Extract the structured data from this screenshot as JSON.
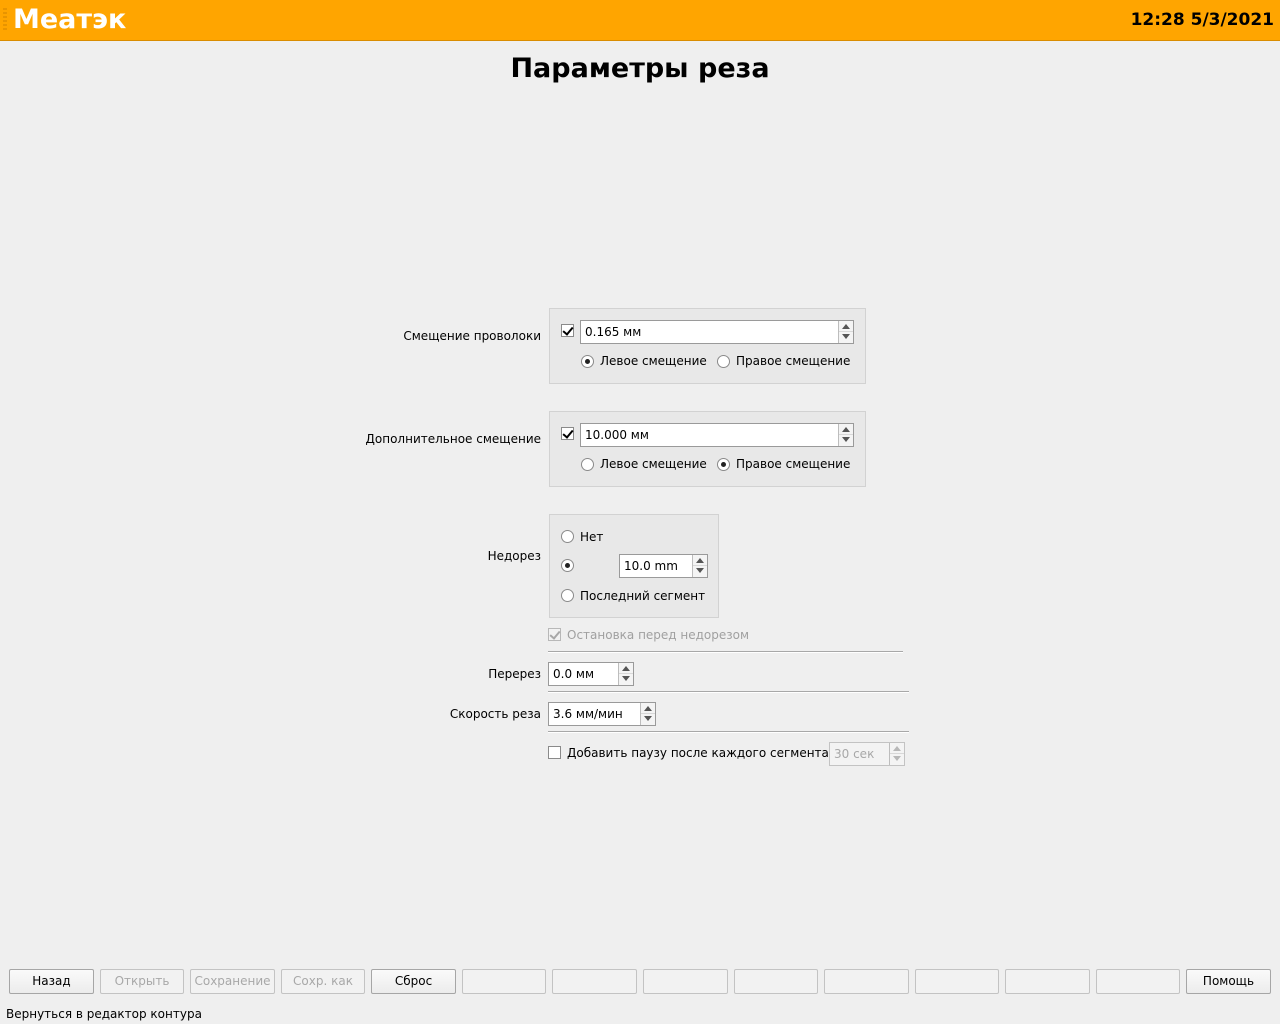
{
  "header": {
    "app_title": "Меатэк",
    "clock": "12:28 5/3/2021",
    "bg_color": "#ffa500"
  },
  "page_title": "Параметры реза",
  "wire_offset": {
    "label": "Смещение проволоки",
    "enabled": true,
    "value": "0.165 мм",
    "left_label": "Левое смещение",
    "right_label": "Правое смещение",
    "selected": "left"
  },
  "extra_offset": {
    "label": "Дополнительное смещение",
    "enabled": true,
    "value": "10.000 мм",
    "left_label": "Левое смещение",
    "right_label": "Правое смещение",
    "selected": "right"
  },
  "undercut": {
    "label": "Недорез",
    "none_label": "Нет",
    "value": "10.0 mm",
    "last_segment_label": "Последний сегмент",
    "selected": "value"
  },
  "stop_before_undercut": {
    "label": "Остановка перед недорезом",
    "checked": true,
    "disabled": true
  },
  "overcut": {
    "label": "Перерез",
    "value": "0.0 мм"
  },
  "cut_speed": {
    "label": "Скорость реза",
    "value": "3.6 мм/мин"
  },
  "pause": {
    "label": "Добавить паузу после каждого сегмента",
    "checked": false,
    "value": "30 сек",
    "value_disabled": true
  },
  "footer": {
    "buttons": [
      {
        "label": "Назад",
        "enabled": true
      },
      {
        "label": "Открыть",
        "enabled": false
      },
      {
        "label": "Сохранение",
        "enabled": false
      },
      {
        "label": "Сохр. как",
        "enabled": false
      },
      {
        "label": "Сброс",
        "enabled": true
      },
      {
        "label": "",
        "enabled": false
      },
      {
        "label": "",
        "enabled": false
      },
      {
        "label": "",
        "enabled": false
      },
      {
        "label": "",
        "enabled": false
      },
      {
        "label": "",
        "enabled": false
      },
      {
        "label": "",
        "enabled": false
      },
      {
        "label": "",
        "enabled": false
      },
      {
        "label": "",
        "enabled": false
      },
      {
        "label": "Помощь",
        "enabled": true
      }
    ],
    "status": "Вернуться в редактор контура"
  }
}
